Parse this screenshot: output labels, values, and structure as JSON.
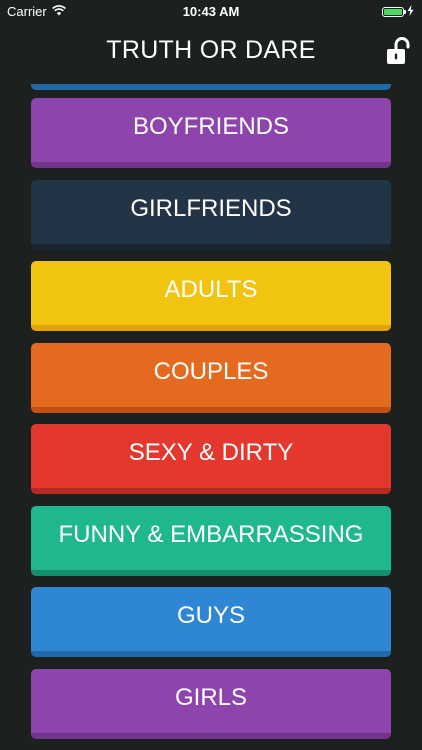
{
  "status_bar": {
    "carrier": "Carrier",
    "time": "10:43 AM",
    "battery_level": 1.0,
    "battery_color": "#4cd964"
  },
  "nav": {
    "title": "TRUTH OR DARE",
    "lock_icon": "unlocked-padlock-icon"
  },
  "categories": [
    {
      "label": "BOYFRIENDS",
      "color": "#8e44ad",
      "shadow": "#71348a"
    },
    {
      "label": "GIRLFRIENDS",
      "color": "#243447",
      "shadow": "#1a2633"
    },
    {
      "label": "ADULTS",
      "color": "#f1c40f",
      "shadow": "#e3a20d"
    },
    {
      "label": "COUPLES",
      "color": "#e46a1f",
      "shadow": "#c24f14"
    },
    {
      "label": "SEXY & DIRTY",
      "color": "#e4382f",
      "shadow": "#b52a23"
    },
    {
      "label": "FUNNY & EMBARRASSING",
      "color": "#1fb78e",
      "shadow": "#178d6e"
    },
    {
      "label": "GUYS",
      "color": "#2e86d4",
      "shadow": "#216aa8"
    },
    {
      "label": "GIRLS",
      "color": "#8e44ad",
      "shadow": "#71348a"
    }
  ]
}
